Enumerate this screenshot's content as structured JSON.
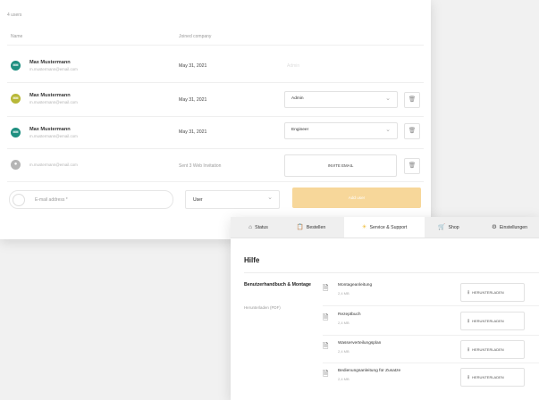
{
  "users": {
    "count_label": "4 users",
    "col_name": "Name",
    "col_joined": "Joined company",
    "rows": [
      {
        "initials": "MM",
        "name": "Max Mustermann",
        "email": "m.mustermann@email.com",
        "date": "May 31, 2021",
        "role": "Admin",
        "avatar_color": "#1f8f80"
      },
      {
        "initials": "MM",
        "name": "Max Mustermann",
        "email": "m.mustermann@email.com",
        "date": "May 31, 2021",
        "role": "Admin",
        "avatar_color": "#b8b838"
      },
      {
        "initials": "MM",
        "name": "Max Mustermann",
        "email": "m.mustermann@email.com",
        "date": "May 31, 2021",
        "role": "Engineer",
        "avatar_color": "#1f8f80"
      }
    ],
    "pending": {
      "email": "m.mustermann@email.com",
      "status": "Sent 3 Web Invitation",
      "button": "INVITE EMAIL",
      "avatar_color": "#b5b5b5"
    },
    "invite": {
      "placeholder": "E-mail address *",
      "role": "User",
      "button": "Add user",
      "button_color": "#f7d79a"
    }
  },
  "help": {
    "tabs": [
      {
        "icon": "home-icon",
        "label": "Status"
      },
      {
        "icon": "clipboard-icon",
        "label": "Bestellen"
      },
      {
        "icon": "lightbulb-icon",
        "label": "Service & Support"
      },
      {
        "icon": "cart-icon",
        "label": "Shop"
      },
      {
        "icon": "gear-icon",
        "label": "Einstellungen"
      }
    ],
    "title": "Hilfe",
    "section_title": "Benutzerhandbuch & Montage",
    "section_subtitle": "Herunterladen (PDF)",
    "docs": [
      {
        "title": "Montageanleitung",
        "size": "2,4 MB",
        "button": "HERUNTERLADEN"
      },
      {
        "title": "Rezeptbuch",
        "size": "2,4 MB",
        "button": "HERUNTERLADEN"
      },
      {
        "title": "Wasserverteilungsplan",
        "size": "2,4 MB",
        "button": "HERUNTERLADEN"
      },
      {
        "title": "Bedienungsanleitung für Zusatze",
        "size": "2,4 MB",
        "button": "HERUNTERLADEN"
      }
    ]
  }
}
